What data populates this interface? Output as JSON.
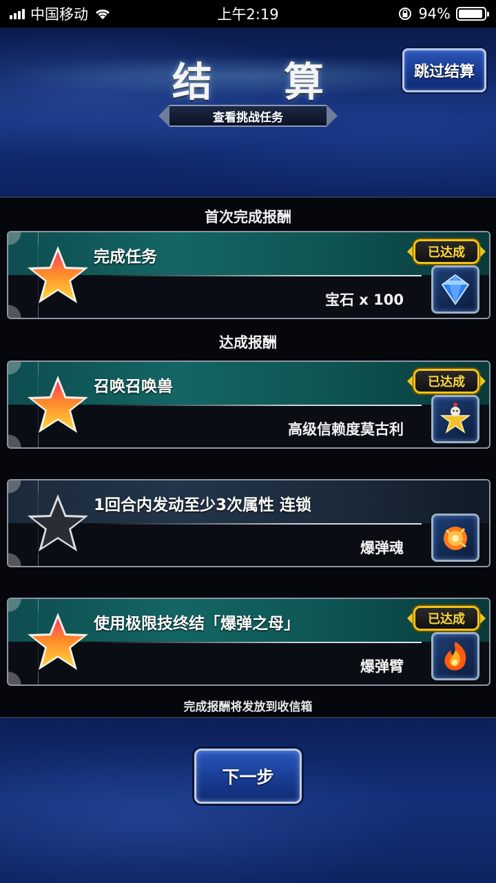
{
  "status_bar": {
    "carrier": "中国移动",
    "time": "上午2:19",
    "battery_text": "94%",
    "battery_level": 0.94,
    "icons": [
      "signal-icon",
      "wifi-icon",
      "rotation-lock-icon",
      "battery-icon"
    ]
  },
  "header": {
    "title": "结 算",
    "skip_button": "跳过结算",
    "mission_tab": "查看挑战任务"
  },
  "sections": {
    "first_clear": "首次完成报酬",
    "achievement": "达成报酬"
  },
  "cards": [
    {
      "title": "完成任务",
      "reward": "宝石 x 100",
      "achieved": true,
      "badge": "已达成",
      "star": "gold",
      "item_icon": "gem-icon"
    },
    {
      "title": "召唤召唤兽",
      "reward": "高级信赖度莫古利",
      "achieved": true,
      "badge": "已达成",
      "star": "gold",
      "item_icon": "moogle-star-icon"
    },
    {
      "title": "1回合内发动至少3次属性 连锁",
      "reward": "爆弹魂",
      "achieved": false,
      "badge": "",
      "star": "gray",
      "item_icon": "bomb-soul-icon"
    },
    {
      "title": "使用极限技终结「爆弹之母」",
      "reward": "爆弹臂",
      "achieved": true,
      "badge": "已达成",
      "star": "gold",
      "item_icon": "bomb-arm-icon"
    }
  ],
  "footer_note": "完成报酬将发放到收信箱",
  "next_button": "下一步",
  "colors": {
    "badge_gold": "#f2c518",
    "card_teal": "#136664",
    "button_blue": "#183c92"
  }
}
